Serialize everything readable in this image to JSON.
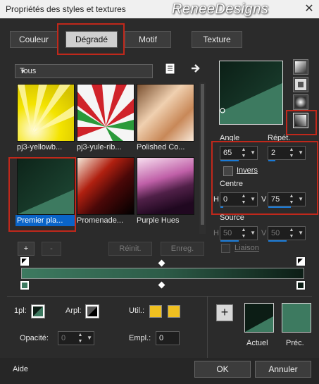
{
  "window": {
    "title": "Propriétés des styles et textures",
    "watermark": "ReneeDesigns",
    "close_glyph": "✕"
  },
  "tabs": [
    {
      "label": "Couleur",
      "active": false
    },
    {
      "label": "Dégradé",
      "active": true
    },
    {
      "label": "Motif",
      "active": false
    },
    {
      "label": "Texture",
      "active": false
    }
  ],
  "filter": {
    "selected": "Tous"
  },
  "gradients": [
    {
      "label": "pj3-yellowb...",
      "selected": false
    },
    {
      "label": "pj3-yule-rib...",
      "selected": false
    },
    {
      "label": "Polished Co...",
      "selected": false
    },
    {
      "label": "Premier pla...",
      "selected": true
    },
    {
      "label": "Promenade...",
      "selected": false
    },
    {
      "label": "Purple Hues",
      "selected": false
    }
  ],
  "list_buttons": {
    "add": "+",
    "remove": "-",
    "reset": "Réinit.",
    "save": "Enreg."
  },
  "params": {
    "angle_label": "Angle",
    "angle": "65",
    "repeat_label": "Répét.",
    "repeat": "2",
    "invert_label": "Invers",
    "center_label": "Centre",
    "h_label": "H",
    "h": "0",
    "v_label": "V",
    "v": "75",
    "source_label": "Source",
    "source_h": "50",
    "source_v": "50",
    "link_label": "Liaison"
  },
  "stops": {
    "first_label": "1pl:",
    "rear_label": "Arpl:",
    "util_label": "Util.:",
    "opacity_label": "Opacité:",
    "opacity": "0",
    "position_label": "Empl.:",
    "position": "0"
  },
  "preview": {
    "current_label": "Actuel",
    "previous_label": "Préc.",
    "add_glyph": "+"
  },
  "footer": {
    "help": "Aide",
    "ok": "OK",
    "cancel": "Annuler"
  },
  "colors": {
    "dark_green": "#0f2a20",
    "mid_green": "#3d7a60",
    "accent": "#0a64c8",
    "util": "#f0c020",
    "highlight": "#c0281b"
  }
}
